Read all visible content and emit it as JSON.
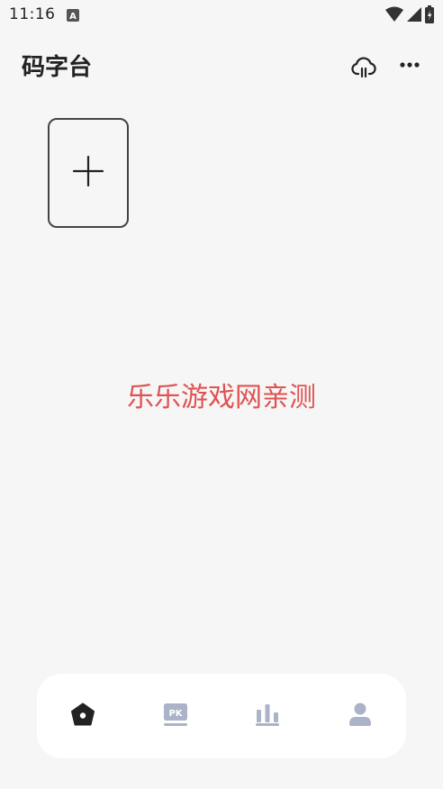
{
  "status_bar": {
    "time": "11:16"
  },
  "header": {
    "title": "码字台",
    "icons": [
      "cloud-sync-icon",
      "more-icon"
    ]
  },
  "main": {
    "add_card_icon": "plus-icon"
  },
  "watermark": {
    "text": "乐乐游戏网亲测"
  },
  "bottom_nav": {
    "items": [
      {
        "name": "home",
        "icon": "home-icon",
        "active": true
      },
      {
        "name": "pk",
        "icon": "pk-icon",
        "active": false
      },
      {
        "name": "stats",
        "icon": "bar-chart-icon",
        "active": false
      },
      {
        "name": "profile",
        "icon": "person-icon",
        "active": false
      }
    ]
  },
  "colors": {
    "background": "#f6f6f6",
    "watermark": "#e05252",
    "nav_active": "#222222",
    "nav_inactive": "#aab3c7"
  }
}
